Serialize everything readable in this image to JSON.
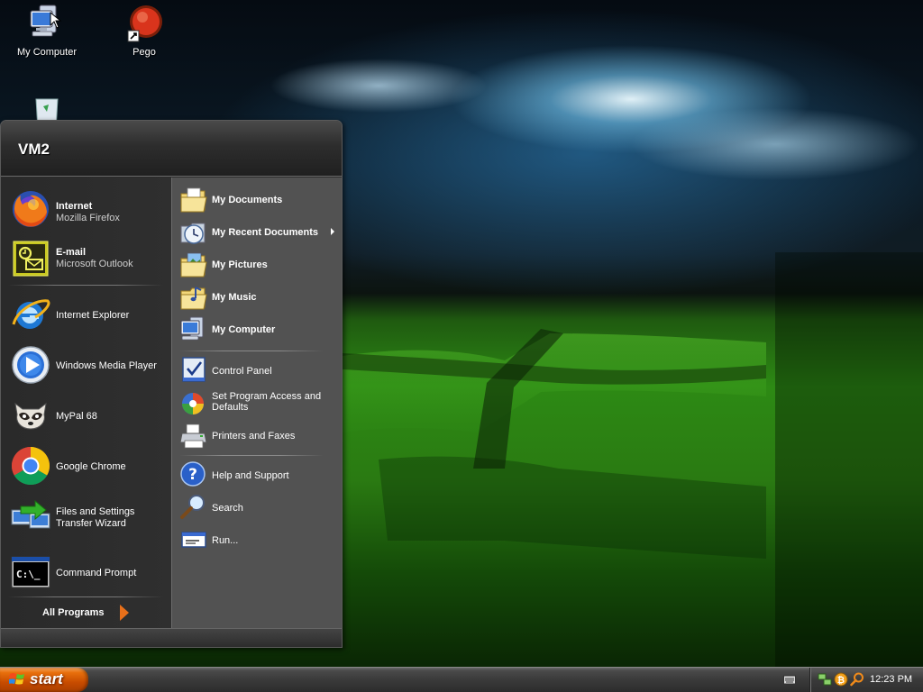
{
  "desktop": {
    "icons": [
      {
        "label": "My Computer"
      },
      {
        "label": "Pego"
      }
    ]
  },
  "start_menu": {
    "user_name": "VM2",
    "pinned": [
      {
        "title": "Internet",
        "subtitle": "Mozilla Firefox"
      },
      {
        "title": "E-mail",
        "subtitle": "Microsoft Outlook"
      }
    ],
    "recent": [
      {
        "title": "Internet Explorer"
      },
      {
        "title": "Windows Media Player"
      },
      {
        "title": "MyPal 68"
      },
      {
        "title": "Google Chrome"
      },
      {
        "title": "Files and Settings",
        "subtitle": "Transfer Wizard"
      },
      {
        "title": "Command Prompt"
      }
    ],
    "all_programs": "All Programs",
    "places": [
      {
        "label": "My Documents"
      },
      {
        "label": "My Recent Documents"
      },
      {
        "label": "My Pictures"
      },
      {
        "label": "My Music"
      },
      {
        "label": "My Computer"
      }
    ],
    "settings": [
      {
        "label": "Control Panel"
      },
      {
        "label": "Set Program Access and",
        "label2": "Defaults"
      },
      {
        "label": "Printers and Faxes"
      }
    ],
    "tools": [
      {
        "label": "Help and Support"
      },
      {
        "label": "Search"
      },
      {
        "label": "Run..."
      }
    ],
    "cmd_prompt_glyph": "C:\\_"
  },
  "taskbar": {
    "start_label": "start",
    "clock": "12:23 PM"
  },
  "colors": {
    "start_orange": "#e8700c",
    "menu_dark": "#2b2b2b",
    "menu_right": "#525252"
  }
}
